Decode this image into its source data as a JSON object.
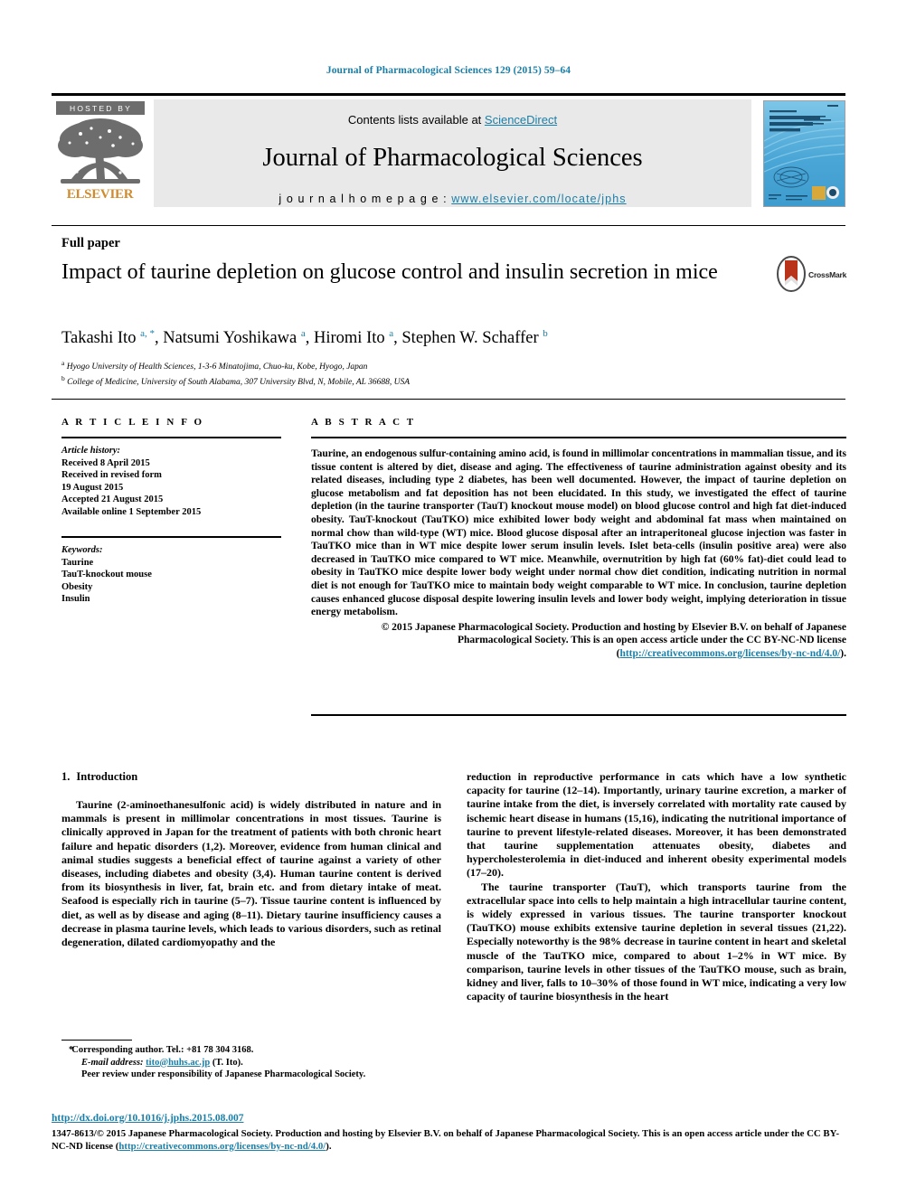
{
  "running_head": "Journal of Pharmacological Sciences 129 (2015) 59–64",
  "masthead": {
    "hosted_by": "HOSTED BY",
    "publisher": "ELSEVIER",
    "contents_prefix": "Contents lists available at ",
    "sciencedirect": "ScienceDirect",
    "journal_title": "Journal of Pharmacological Sciences",
    "homepage_prefix": "j o u r n a l   h o m e p a g e :   ",
    "homepage_url": "www.elsevier.com/locate/jphs",
    "cover_caption": "Journal of Pharmacological Sciences"
  },
  "article": {
    "type": "Full paper",
    "title": "Impact of taurine depletion on glucose control and insulin secretion in mice",
    "crossmark_label": "CrossMark",
    "authors_html": "Takashi Ito <sup>a, *</sup>, Natsumi Yoshikawa <sup>a</sup>, Hiromi Ito <sup>a</sup>, Stephen W. Schaffer <sup>b</sup>",
    "affiliations": [
      {
        "marker": "a",
        "text": "Hyogo University of Health Sciences, 1-3-6 Minatojima, Chuo-ku, Kobe, Hyogo, Japan"
      },
      {
        "marker": "b",
        "text": "College of Medicine, University of South Alabama, 307 University Blvd, N, Mobile, AL 36688, USA"
      }
    ]
  },
  "info": {
    "heading": "A R T I C L E   I N F O",
    "history_label": "Article history:",
    "history": [
      "Received 8 April 2015",
      "Received in revised form",
      "19 August 2015",
      "Accepted 21 August 2015",
      "Available online 1 September 2015"
    ],
    "keywords_label": "Keywords:",
    "keywords": [
      "Taurine",
      "TauT-knockout mouse",
      "Obesity",
      "Insulin"
    ]
  },
  "abstract": {
    "heading": "A B S T R A C T",
    "text": "Taurine, an endogenous sulfur-containing amino acid, is found in millimolar concentrations in mammalian tissue, and its tissue content is altered by diet, disease and aging. The effectiveness of taurine administration against obesity and its related diseases, including type 2 diabetes, has been well documented. However, the impact of taurine depletion on glucose metabolism and fat deposition has not been elucidated. In this study, we investigated the effect of taurine depletion (in the taurine transporter (TauT) knockout mouse model) on blood glucose control and high fat diet-induced obesity. TauT-knockout (TauTKO) mice exhibited lower body weight and abdominal fat mass when maintained on normal chow than wild-type (WT) mice. Blood glucose disposal after an intraperitoneal glucose injection was faster in TauTKO mice than in WT mice despite lower serum insulin levels. Islet beta-cells (insulin positive area) were also decreased in TauTKO mice compared to WT mice. Meanwhile, overnutrition by high fat (60% fat)-diet could lead to obesity in TauTKO mice despite lower body weight under normal chow diet condition, indicating nutrition in normal diet is not enough for TauTKO mice to maintain body weight comparable to WT mice. In conclusion, taurine depletion causes enhanced glucose disposal despite lowering insulin levels and lower body weight, implying deterioration in tissue energy metabolism.",
    "copyright": "© 2015 Japanese Pharmacological Society. Production and hosting by Elsevier B.V. on behalf of Japanese Pharmacological Society. This is an open access article under the CC BY-NC-ND license (",
    "copyright_link": "http://creativecommons.org/licenses/by-nc-nd/4.0/",
    "copyright_tail": ")."
  },
  "body": {
    "intro_number": "1.",
    "intro_heading": "Introduction",
    "left_paragraphs": [
      "Taurine (2-aminoethanesulfonic acid) is widely distributed in nature and in mammals is present in millimolar concentrations in most tissues. Taurine is clinically approved in Japan for the treatment of patients with both chronic heart failure and hepatic disorders (1,2). Moreover, evidence from human clinical and animal studies suggests a beneficial effect of taurine against a variety of other diseases, including diabetes and obesity (3,4). Human taurine content is derived from its biosynthesis in liver, fat, brain etc. and from dietary intake of meat. Seafood is especially rich in taurine (5–7). Tissue taurine content is influenced by diet, as well as by disease and aging (8–11). Dietary taurine insufficiency causes a decrease in plasma taurine levels, which leads to various disorders, such as retinal degeneration, dilated cardiomyopathy and the"
    ],
    "right_paragraphs": [
      "reduction in reproductive performance in cats which have a low synthetic capacity for taurine (12–14). Importantly, urinary taurine excretion, a marker of taurine intake from the diet, is inversely correlated with mortality rate caused by ischemic heart disease in humans (15,16), indicating the nutritional importance of taurine to prevent lifestyle-related diseases. Moreover, it has been demonstrated that taurine supplementation attenuates obesity, diabetes and hypercholesterolemia in diet-induced and inherent obesity experimental models (17–20).",
      "The taurine transporter (TauT), which transports taurine from the extracellular space into cells to help maintain a high intracellular taurine content, is widely expressed in various tissues. The taurine transporter knockout (TauTKO) mouse exhibits extensive taurine depletion in several tissues (21,22). Especially noteworthy is the 98% decrease in taurine content in heart and skeletal muscle of the TauTKO mice, compared to about 1–2% in WT mice. By comparison, taurine levels in other tissues of the TauTKO mouse, such as brain, kidney and liver, falls to 10–30% of those found in WT mice, indicating a very low capacity of taurine biosynthesis in the heart"
    ]
  },
  "footnote": {
    "corresponding": "Corresponding author. Tel.: +81 78 304 3168.",
    "email_label": "E-mail address:",
    "email": "tito@huhs.ac.jp",
    "email_tail": " (T. Ito).",
    "peer_review": "Peer review under responsibility of Japanese Pharmacological Society."
  },
  "bottom": {
    "doi": "http://dx.doi.org/10.1016/j.jphs.2015.08.007",
    "license_lead": "1347-8613/© 2015 Japanese Pharmacological Society. Production and hosting by Elsevier B.V. on behalf of Japanese Pharmacological Society. This is an open access article under the CC BY-NC-ND license (",
    "license_link": "http://creativecommons.org/licenses/by-nc-nd/4.0/",
    "license_tail": ")."
  },
  "colors": {
    "link": "#1a7fa8",
    "elsevier_orange": "#d08b2c",
    "panel_gray": "#e9e9e9",
    "crossmark_red": "#b9321a"
  }
}
